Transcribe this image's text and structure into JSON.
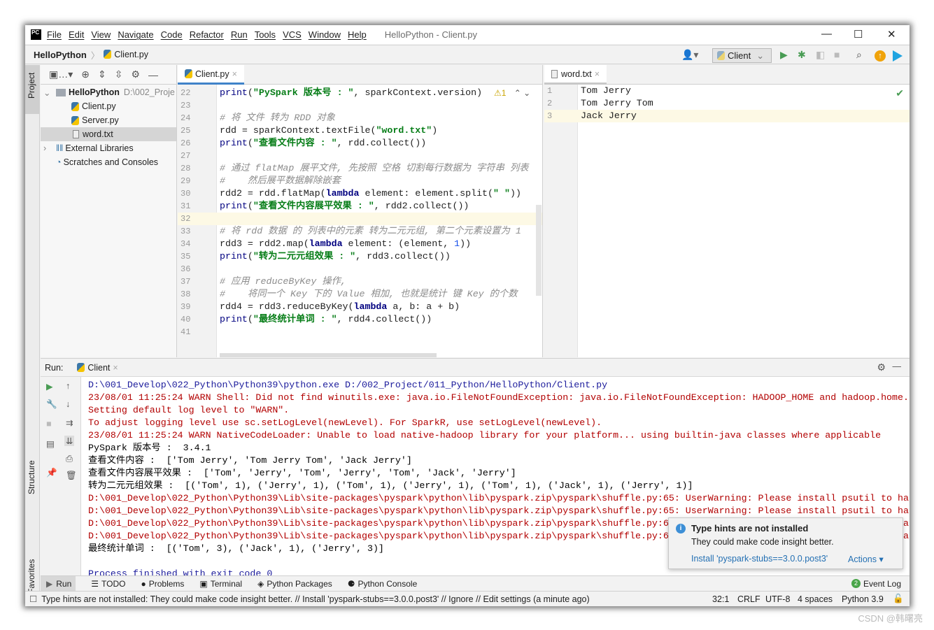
{
  "app": {
    "logo": "PC",
    "window_title": "HelloPython - Client.py",
    "menu": [
      "File",
      "Edit",
      "View",
      "Navigate",
      "Code",
      "Refactor",
      "Run",
      "Tools",
      "VCS",
      "Window",
      "Help"
    ]
  },
  "nav": {
    "project": "HelloPython",
    "file": "Client.py",
    "run_config": "Client"
  },
  "stripe": {
    "project": "Project",
    "structure": "Structure",
    "favorites": "Favorites"
  },
  "project_tree": [
    {
      "label": "HelloPython",
      "path": "D:\\002_Proje",
      "type": "root"
    },
    {
      "label": "Client.py",
      "type": "py"
    },
    {
      "label": "Server.py",
      "type": "py"
    },
    {
      "label": "word.txt",
      "type": "txt",
      "selected": true
    },
    {
      "label": "External Libraries",
      "type": "lib"
    },
    {
      "label": "Scratches and Consoles",
      "type": "scratch"
    }
  ],
  "editor": {
    "tab": "Client.py",
    "warning_count": "1",
    "current_line": 32,
    "lines": [
      {
        "n": "22",
        "t": [
          [
            "fn",
            "print"
          ],
          [
            "",
            "("
          ],
          [
            "str",
            "\"PySpark 版本号 : \""
          ],
          [
            "",
            ", sparkContext.version)"
          ]
        ]
      },
      {
        "n": "23",
        "t": []
      },
      {
        "n": "24",
        "t": [
          [
            "cm",
            "# 将 文件 转为 RDD 对象"
          ]
        ]
      },
      {
        "n": "25",
        "t": [
          [
            "",
            "rdd = sparkContext.textFile("
          ],
          [
            "str",
            "\"word.txt\""
          ],
          [
            "",
            ")"
          ]
        ]
      },
      {
        "n": "26",
        "t": [
          [
            "fn",
            "print"
          ],
          [
            "",
            "("
          ],
          [
            "str",
            "\"查看文件内容 : \""
          ],
          [
            "",
            ", rdd.collect())"
          ]
        ]
      },
      {
        "n": "27",
        "t": []
      },
      {
        "n": "28",
        "t": [
          [
            "cm",
            "# 通过 flatMap 展平文件, 先按照 空格 切割每行数据为 字符串 列表"
          ]
        ]
      },
      {
        "n": "29",
        "t": [
          [
            "cm",
            "#    然后展平数据解除嵌套"
          ]
        ]
      },
      {
        "n": "30",
        "t": [
          [
            "",
            "rdd2 = rdd.flatMap("
          ],
          [
            "kw",
            "lambda"
          ],
          [
            "",
            " element: element.split("
          ],
          [
            "str",
            "\" \""
          ],
          [
            "",
            "))"
          ]
        ]
      },
      {
        "n": "31",
        "t": [
          [
            "fn",
            "print"
          ],
          [
            "",
            "("
          ],
          [
            "str",
            "\"查看文件内容展平效果 : \""
          ],
          [
            "",
            ", rdd2.collect())"
          ]
        ]
      },
      {
        "n": "32",
        "t": []
      },
      {
        "n": "33",
        "t": [
          [
            "cm",
            "# 将 rdd 数据 的 列表中的元素 转为二元元组, 第二个元素设置为 1"
          ]
        ]
      },
      {
        "n": "34",
        "t": [
          [
            "",
            "rdd3 = rdd2.map("
          ],
          [
            "kw",
            "lambda"
          ],
          [
            "",
            " element: (element, "
          ],
          [
            "num",
            "1"
          ],
          [
            "",
            "))"
          ]
        ]
      },
      {
        "n": "35",
        "t": [
          [
            "fn",
            "print"
          ],
          [
            "",
            "("
          ],
          [
            "str",
            "\"转为二元元组效果 : \""
          ],
          [
            "",
            ", rdd3.collect())"
          ]
        ]
      },
      {
        "n": "36",
        "t": []
      },
      {
        "n": "37",
        "t": [
          [
            "cm",
            "# 应用 reduceByKey 操作,"
          ]
        ]
      },
      {
        "n": "38",
        "t": [
          [
            "cm",
            "#    将同一个 Key 下的 Value 相加, 也就是统计 键 Key 的个数"
          ]
        ]
      },
      {
        "n": "39",
        "t": [
          [
            "",
            "rdd4 = rdd3.reduceByKey("
          ],
          [
            "kw",
            "lambda"
          ],
          [
            "",
            " a, b: a + b)"
          ]
        ]
      },
      {
        "n": "40",
        "t": [
          [
            "fn",
            "print"
          ],
          [
            "",
            "("
          ],
          [
            "str",
            "\"最终统计单词 : \""
          ],
          [
            "",
            ", rdd4.collect())"
          ]
        ]
      },
      {
        "n": "41",
        "t": []
      }
    ]
  },
  "word_editor": {
    "tab": "word.txt",
    "current_line": 3,
    "lines": [
      {
        "n": "1",
        "t": [
          [
            "",
            "Tom Jerry"
          ]
        ]
      },
      {
        "n": "2",
        "t": [
          [
            "",
            "Tom Jerry Tom"
          ]
        ]
      },
      {
        "n": "3",
        "t": [
          [
            "",
            "Jack Jerry"
          ]
        ]
      }
    ]
  },
  "run": {
    "label": "Run:",
    "tab": "Client",
    "output": [
      [
        "blue",
        "D:\\001_Develop\\022_Python\\Python39\\python.exe D:/002_Project/011_Python/HelloPython/Client.py"
      ],
      [
        "red",
        "23/08/01 11:25:24 WARN Shell: Did not find winutils.exe: java.io.FileNotFoundException: java.io.FileNotFoundException: HADOOP_HOME and hadoop.home."
      ],
      [
        "red",
        "Setting default log level to \"WARN\"."
      ],
      [
        "red",
        "To adjust logging level use sc.setLogLevel(newLevel). For SparkR, use setLogLevel(newLevel)."
      ],
      [
        "red",
        "23/08/01 11:25:24 WARN NativeCodeLoader: Unable to load native-hadoop library for your platform... using builtin-java classes where applicable"
      ],
      [
        "blk",
        "PySpark 版本号 :  3.4.1"
      ],
      [
        "blk",
        "查看文件内容 :  ['Tom Jerry', 'Tom Jerry Tom', 'Jack Jerry']"
      ],
      [
        "blk",
        "查看文件内容展平效果 :  ['Tom', 'Jerry', 'Tom', 'Jerry', 'Tom', 'Jack', 'Jerry']"
      ],
      [
        "blk",
        "转为二元元组效果 :  [('Tom', 1), ('Jerry', 1), ('Tom', 1), ('Jerry', 1), ('Tom', 1), ('Jack', 1), ('Jerry', 1)]"
      ],
      [
        "red",
        "D:\\001_Develop\\022_Python\\Python39\\Lib\\site-packages\\pyspark\\python\\lib\\pyspark.zip\\pyspark\\shuffle.py:65: UserWarning: Please install psutil to ha"
      ],
      [
        "red",
        "D:\\001_Develop\\022_Python\\Python39\\Lib\\site-packages\\pyspark\\python\\lib\\pyspark.zip\\pyspark\\shuffle.py:65: UserWarning: Please install psutil to ha"
      ],
      [
        "red",
        "D:\\001_Develop\\022_Python\\Python39\\Lib\\site-packages\\pyspark\\python\\lib\\pyspark.zip\\pyspark\\shuffle.py:65: UserWarning: Please install psutil to ha"
      ],
      [
        "red",
        "D:\\001_Develop\\022_Python\\Python39\\Lib\\site-packages\\pyspark\\python\\lib\\pyspark.zip\\pyspark\\shuffle.py:65: UserWarning: Please install psutil to ha"
      ],
      [
        "blk",
        "最终统计单词 :  [('Tom', 3), ('Jack', 1), ('Jerry', 3)]"
      ],
      [
        "blk",
        ""
      ],
      [
        "blue",
        "Process finished with exit code 0"
      ]
    ]
  },
  "bottom_tools": [
    "Run",
    "TODO",
    "Problems",
    "Terminal",
    "Python Packages",
    "Python Console"
  ],
  "event_log": {
    "label": "Event Log",
    "count": "2"
  },
  "popup": {
    "title": "Type hints are not installed",
    "body": "They could make code insight better.",
    "install": "Install 'pyspark-stubs==3.0.0.post3'",
    "actions": "Actions ▾"
  },
  "status": {
    "message": "Type hints are not installed: They could make code insight better. // Install 'pyspark-stubs==3.0.0.post3' // Ignore // Edit settings (a minute ago)",
    "position": "32:1",
    "line_sep": "CRLF",
    "encoding": "UTF-8",
    "indent": "4 spaces",
    "interpreter": "Python 3.9"
  },
  "watermark": "CSDN @韩曙亮",
  "colors": {
    "accent": "#4083c9",
    "run_green": "#499c54",
    "string_green": "#067d17",
    "error_red": "#b20000",
    "current_line": "#fdf9e5"
  }
}
